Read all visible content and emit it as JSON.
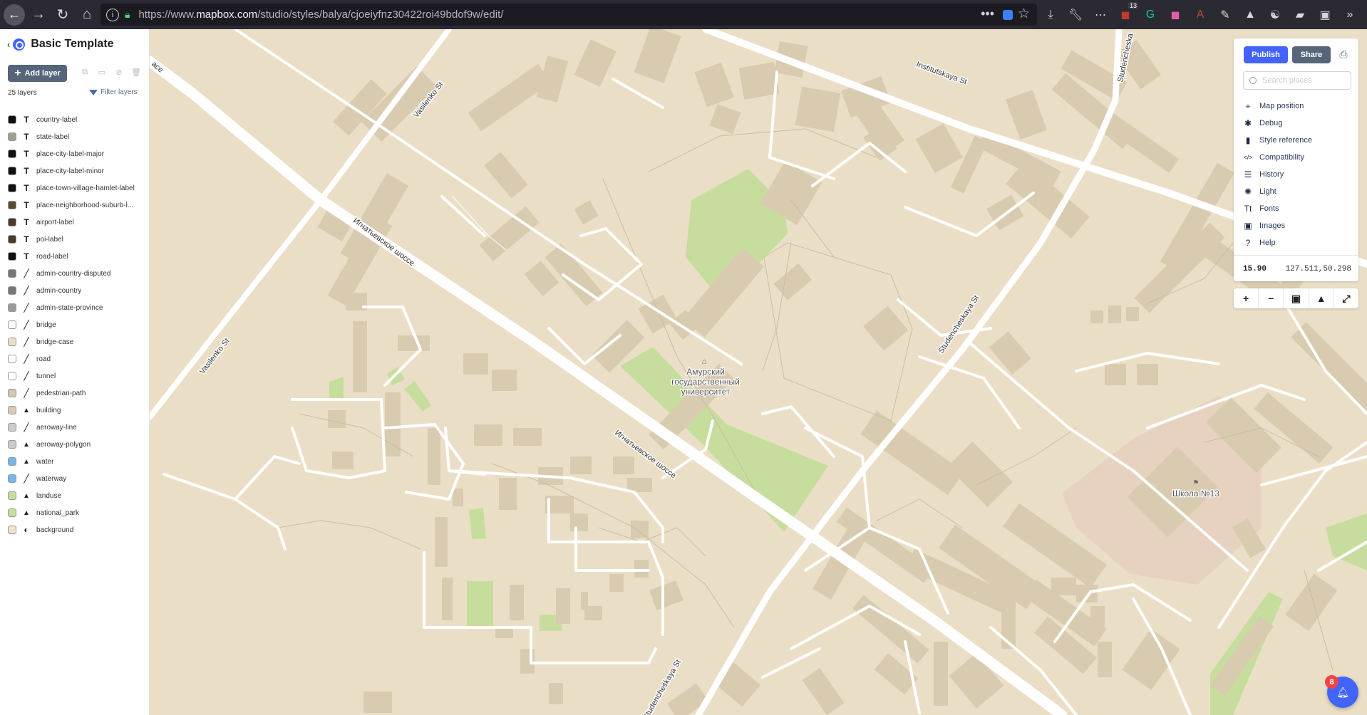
{
  "browser": {
    "url_prefix": "https://www.",
    "url_domain": "mapbox.com",
    "url_path": "/studio/styles/balya/cjoeiyfnz30422roi49bdof9w/edit/",
    "extension_badge": "13"
  },
  "studio": {
    "style_name": "Basic Template",
    "add_layer_label": "Add layer",
    "layer_count": "25 layers",
    "filter_label": "Filter layers",
    "layers": [
      {
        "name": "country-label",
        "type": "symbol",
        "color": "#111111"
      },
      {
        "name": "state-label",
        "type": "symbol",
        "color": "#a39e8e"
      },
      {
        "name": "place-city-label-major",
        "type": "symbol",
        "color": "#111111"
      },
      {
        "name": "place-city-label-minor",
        "type": "symbol",
        "color": "#111111"
      },
      {
        "name": "place-town-village-hamlet-label",
        "type": "symbol",
        "color": "#111111"
      },
      {
        "name": "place-neighborhood-suburb-l...",
        "type": "symbol",
        "color": "#5b4a2b"
      },
      {
        "name": "airport-label",
        "type": "symbol-icon",
        "color": "#4a3a2a"
      },
      {
        "name": "poi-label",
        "type": "symbol-icon",
        "color": "#4a3a2a"
      },
      {
        "name": "road-label",
        "type": "symbol",
        "color": "#111111"
      },
      {
        "name": "admin-country-disputed",
        "type": "line",
        "color": "#777777"
      },
      {
        "name": "admin-country",
        "type": "line",
        "color": "#777777"
      },
      {
        "name": "admin-state-province",
        "type": "line",
        "color": "#999999"
      },
      {
        "name": "bridge",
        "type": "line",
        "color": "#ffffff"
      },
      {
        "name": "bridge-case",
        "type": "line",
        "color": "#e9dfc8"
      },
      {
        "name": "road",
        "type": "line",
        "color": "#ffffff"
      },
      {
        "name": "tunnel",
        "type": "line",
        "color": "#ffffff"
      },
      {
        "name": "pedestrian-path",
        "type": "line",
        "color": "#d3c7ae"
      },
      {
        "name": "building",
        "type": "fill",
        "color": "#d8cbb0"
      },
      {
        "name": "aeroway-line",
        "type": "line",
        "color": "#cccccc"
      },
      {
        "name": "aeroway-polygon",
        "type": "fill",
        "color": "#cccccc"
      },
      {
        "name": "water",
        "type": "fill",
        "color": "#75b7e8"
      },
      {
        "name": "waterway",
        "type": "line",
        "color": "#75b7e8"
      },
      {
        "name": "landuse",
        "type": "fill",
        "color": "#c8dd9a"
      },
      {
        "name": "national_park",
        "type": "fill",
        "color": "#c8dd9a"
      },
      {
        "name": "background",
        "type": "background",
        "color": "#efe3ce"
      }
    ]
  },
  "toolpanel": {
    "publish_label": "Publish",
    "share_label": "Share",
    "search_placeholder": "Search places",
    "menu": [
      {
        "label": "Map position",
        "icon": "crosshair-icon",
        "glyph": "⌖"
      },
      {
        "label": "Debug",
        "icon": "bug-icon",
        "glyph": "✱"
      },
      {
        "label": "Style reference",
        "icon": "book-icon",
        "glyph": "▮"
      },
      {
        "label": "Compatibility",
        "icon": "code-icon",
        "glyph": "</>"
      },
      {
        "label": "History",
        "icon": "history-icon",
        "glyph": "☰"
      },
      {
        "label": "Light",
        "icon": "light-icon",
        "glyph": "✺"
      },
      {
        "label": "Fonts",
        "icon": "fonts-icon",
        "glyph": "Tt"
      },
      {
        "label": "Images",
        "icon": "images-icon",
        "glyph": "▣"
      },
      {
        "label": "Help",
        "icon": "help-icon",
        "glyph": "?"
      }
    ],
    "zoom": "15.90",
    "coordinates": "127.511,50.298"
  },
  "map": {
    "streets": {
      "vasilenko_1": "Vasilenko St",
      "vasilenko_2": "Vasilenko St",
      "institutskaya": "Institutskaya St",
      "studencheskaya_top": "Studencheska",
      "studencheskaya_mid": "Studencheskaya St",
      "studencheskaya_bottom": "Studencheskaya St",
      "ignatievskoe_1": "Игнатьевское шоссе",
      "ignatievskoe_2": "Игнатьевское шоссе",
      "edge_left": "ace"
    },
    "poi_university": [
      "Амурский",
      "государственный",
      "университет"
    ],
    "poi_school": "Школа №13",
    "notifications_count": "8"
  }
}
